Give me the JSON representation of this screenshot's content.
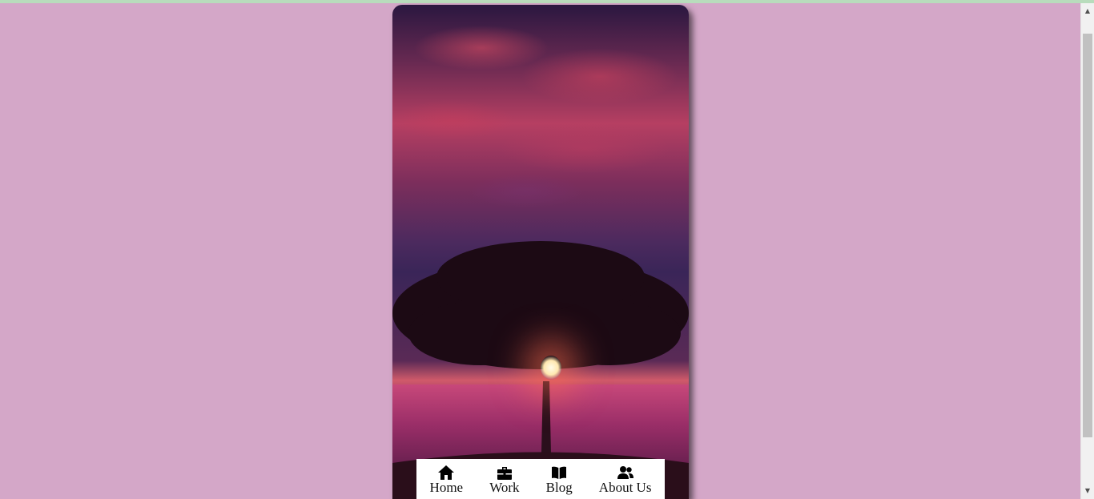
{
  "nav": {
    "items": [
      {
        "label": "Home",
        "icon": "home-icon"
      },
      {
        "label": "Work",
        "icon": "briefcase-icon"
      },
      {
        "label": "Blog",
        "icon": "book-icon"
      },
      {
        "label": "About Us",
        "icon": "users-icon"
      }
    ]
  },
  "colors": {
    "page_background": "#d4a7c8",
    "nav_background": "#ffffff",
    "top_strip": "#b8dcbc"
  },
  "scrollbar": {
    "up_arrow": "▲",
    "down_arrow": "▼"
  }
}
